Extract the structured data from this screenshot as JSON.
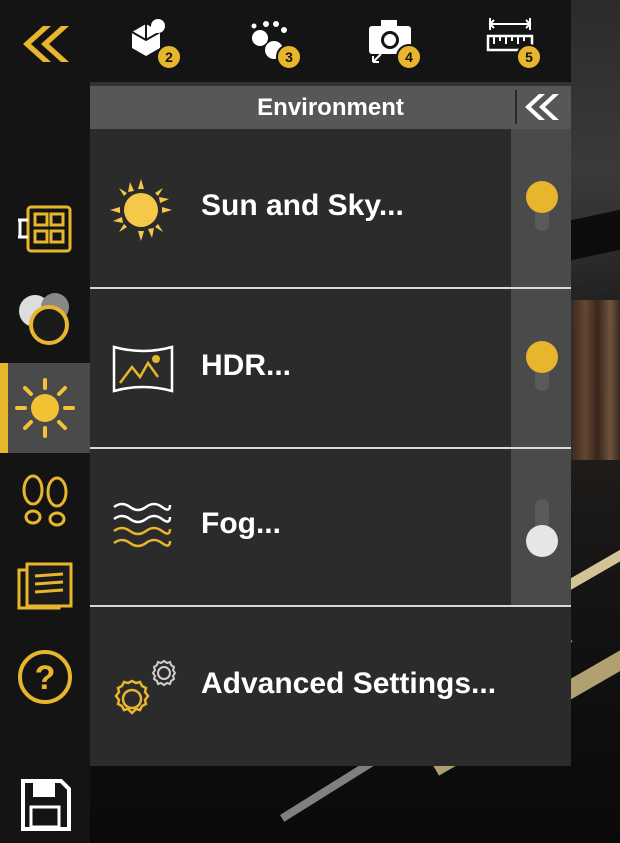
{
  "toolbar": {
    "tools": [
      {
        "icon": "objects-icon",
        "badge": "2"
      },
      {
        "icon": "path-icon",
        "badge": "3"
      },
      {
        "icon": "camera-icon",
        "badge": "4"
      },
      {
        "icon": "measure-icon",
        "badge": "5"
      }
    ]
  },
  "sidebar": {
    "items": [
      {
        "icon": "collapse-left-icon",
        "active": false
      },
      {
        "icon": "layout-icon",
        "active": false
      },
      {
        "icon": "materials-icon",
        "active": false
      },
      {
        "icon": "sun-icon",
        "active": true
      },
      {
        "icon": "footsteps-icon",
        "active": false
      },
      {
        "icon": "notes-icon",
        "active": false
      },
      {
        "icon": "help-icon",
        "active": false
      },
      {
        "icon": "save-icon",
        "active": false
      }
    ]
  },
  "panel": {
    "title": "Environment",
    "rows": [
      {
        "label": "Sun and Sky...",
        "icon": "sun-icon",
        "toggle": "on"
      },
      {
        "label": "HDR...",
        "icon": "hdr-panorama-icon",
        "toggle": "on"
      },
      {
        "label": "Fog...",
        "icon": "fog-icon",
        "toggle": "off"
      },
      {
        "label": "Advanced Settings...",
        "icon": "gears-icon"
      }
    ]
  },
  "colors": {
    "accent": "#e8b62c",
    "panel": "#2b2b2b",
    "header": "#575757",
    "rail": "#141414",
    "toggle_off": "#e6e6e6"
  }
}
